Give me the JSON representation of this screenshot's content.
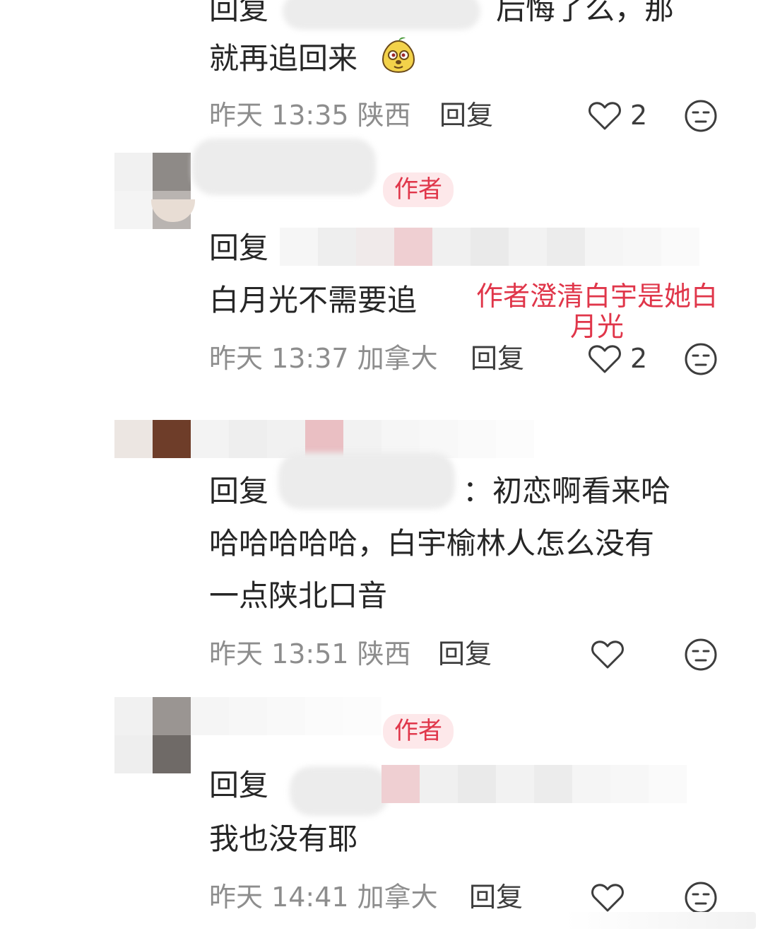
{
  "comments": [
    {
      "line1_prefix": "回复",
      "line1_suffix": "后悔了么，那",
      "line2": "就再追回来",
      "meta": "昨天 13:35 陕西",
      "reply_label": "回复",
      "likes": "2"
    },
    {
      "badge": "作者",
      "line1_prefix": "回复",
      "line2": "白月光不需要追",
      "meta": "昨天 13:37 加拿大",
      "reply_label": "回复",
      "likes": "2"
    },
    {
      "line1_prefix": "回复",
      "line1_suffix": "：初恋啊看来哈",
      "line2": "哈哈哈哈哈，白宇榆林人怎么没有",
      "line3": "一点陕北口音",
      "meta": "昨天 13:51 陕西",
      "reply_label": "回复"
    },
    {
      "badge": "作者",
      "line1_prefix": "回复",
      "line2": "我也没有耶",
      "meta": "昨天 14:41 加拿大",
      "reply_label": "回复"
    }
  ],
  "annotation": {
    "line1": "作者澄清白宇是她白",
    "line2": "月光"
  },
  "icons": {
    "like": "heart-outline-icon",
    "dislike": "neutral-face-icon",
    "emoji": "pear-mascot-emoji"
  },
  "colors": {
    "accent": "#e0364a",
    "badge_bg": "#fde8ea",
    "meta_text": "#8d8d8d"
  }
}
